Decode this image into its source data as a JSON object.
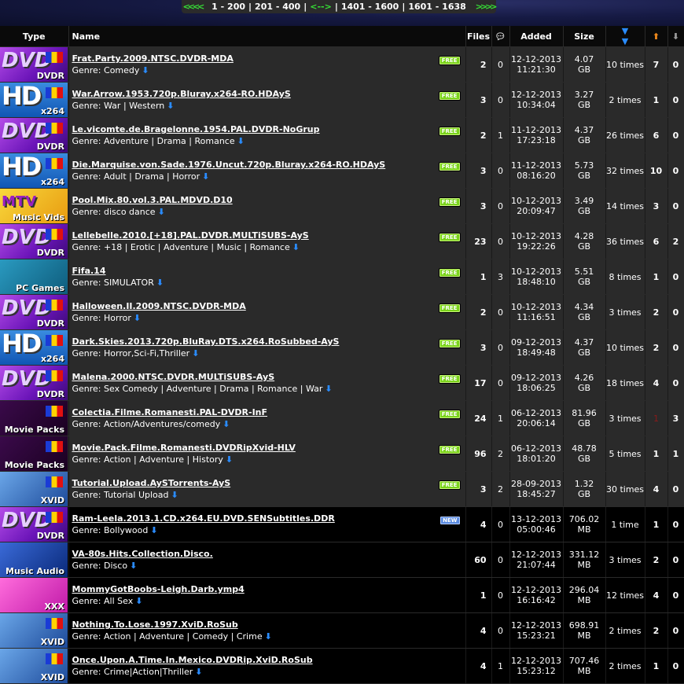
{
  "pager": {
    "left_arrows": "<<<<",
    "range_1": "1 - 200",
    "range_2": "201 - 400",
    "middle": "<-->",
    "range_3": "1401 - 1600",
    "range_4": "1601 - 1638",
    "right_arrows": ">>>>"
  },
  "columns": {
    "type": "Type",
    "name": "Name",
    "files": "Files",
    "comments_icon": "comment-icon",
    "added": "Added",
    "size": "Size",
    "snatched_icon": "snatched-icon",
    "seeders_icon": "up-arrow-icon",
    "leechers_icon": "down-arrow-icon"
  },
  "colors": {
    "free_badge": "#7bd31c",
    "new_badge": "#5a8be0",
    "download_icon": "#2a8cff",
    "dark_row": "#2a2a2a",
    "black_row": "#000000"
  },
  "rows": [
    {
      "cat": "dvd",
      "cat_label": "DVDR",
      "name": "Frat.Party.2009.NTSC.DVDR-MDA",
      "genre": "Genre: Comedy",
      "badge": "FREE",
      "files": "2",
      "comments": "0",
      "date": "12-12-2013",
      "time": "11:21:30",
      "size": "4.07",
      "unit": "GB",
      "snatched": "10 times",
      "seeders": "7",
      "leechers": "0",
      "style": "dark"
    },
    {
      "cat": "hd",
      "cat_label": "x264",
      "name": "War.Arrow.1953.720p.Bluray.x264-RO.HDAyS",
      "genre": "Genre: War | Western",
      "badge": "FREE",
      "files": "3",
      "comments": "0",
      "date": "12-12-2013",
      "time": "10:34:04",
      "size": "3.27",
      "unit": "GB",
      "snatched": "2 times",
      "seeders": "1",
      "leechers": "0",
      "style": "dark"
    },
    {
      "cat": "dvd",
      "cat_label": "DVDR",
      "name": "Le.vicomte.de.Bragelonne.1954.PAL.DVDR-NoGrup",
      "genre": "Genre:  Adventure | Drama | Romance",
      "badge": "FREE",
      "files": "2",
      "comments": "1",
      "date": "11-12-2013",
      "time": "17:23:18",
      "size": "4.37",
      "unit": "GB",
      "snatched": "26 times",
      "seeders": "6",
      "leechers": "0",
      "style": "dark"
    },
    {
      "cat": "hd",
      "cat_label": "x264",
      "name": "Die.Marquise.von.Sade.1976.Uncut.720p.Bluray.x264-RO.HDAyS",
      "genre": "Genre:  Adult | Drama | Horror",
      "badge": "FREE",
      "files": "3",
      "comments": "0",
      "date": "11-12-2013",
      "time": "08:16:20",
      "size": "5.73",
      "unit": "GB",
      "snatched": "32 times",
      "seeders": "10",
      "leechers": "0",
      "style": "dark"
    },
    {
      "cat": "music",
      "cat_label": "Music Vids",
      "name": "Pool.Mix.80.vol.3.PAL.MDVD.D10",
      "genre": "Genre: disco dance",
      "badge": "FREE",
      "files": "3",
      "comments": "0",
      "date": "10-12-2013",
      "time": "20:09:47",
      "size": "3.49",
      "unit": "GB",
      "snatched": "14 times",
      "seeders": "3",
      "leechers": "0",
      "style": "dark"
    },
    {
      "cat": "dvd",
      "cat_label": "DVDR",
      "name": "Lellebelle.2010.[+18].PAL.DVDR.MULTiSUBS-AyS",
      "genre": "Genre: +18 | Erotic | Adventure | Music | Romance",
      "badge": "FREE",
      "files": "23",
      "comments": "0",
      "date": "10-12-2013",
      "time": "19:22:26",
      "size": "4.28",
      "unit": "GB",
      "snatched": "36 times",
      "seeders": "6",
      "leechers": "2",
      "style": "dark"
    },
    {
      "cat": "games",
      "cat_label": "PC Games",
      "name": "Fifa.14",
      "genre": "Genre: SIMULATOR",
      "badge": "FREE",
      "files": "1",
      "comments": "3",
      "date": "10-12-2013",
      "time": "18:48:10",
      "size": "5.51",
      "unit": "GB",
      "snatched": "8 times",
      "seeders": "1",
      "leechers": "0",
      "style": "dark"
    },
    {
      "cat": "dvd",
      "cat_label": "DVDR",
      "name": "Halloween.II.2009.NTSC.DVDR-MDA",
      "genre": "Genre: Horror",
      "badge": "FREE",
      "files": "2",
      "comments": "0",
      "date": "10-12-2013",
      "time": "11:16:51",
      "size": "4.34",
      "unit": "GB",
      "snatched": "3 times",
      "seeders": "2",
      "leechers": "0",
      "style": "dark"
    },
    {
      "cat": "hd",
      "cat_label": "x264",
      "name": "Dark.Skies.2013.720p.BluRay.DTS.x264.RoSubbed-AyS",
      "genre": "Genre: Horror,Sci-Fi,Thriller",
      "badge": "FREE",
      "files": "3",
      "comments": "0",
      "date": "09-12-2013",
      "time": "18:49:48",
      "size": "4.37",
      "unit": "GB",
      "snatched": "10 times",
      "seeders": "2",
      "leechers": "0",
      "style": "dark"
    },
    {
      "cat": "dvd",
      "cat_label": "DVDR",
      "name": "Malena.2000.NTSC.DVDR.MULTiSUBS-AyS",
      "genre": "Genre: Sex Comedy | Adventure | Drama | Romance | War",
      "badge": "FREE",
      "files": "17",
      "comments": "0",
      "date": "09-12-2013",
      "time": "18:06:25",
      "size": "4.26",
      "unit": "GB",
      "snatched": "18 times",
      "seeders": "4",
      "leechers": "0",
      "style": "dark"
    },
    {
      "cat": "movie",
      "cat_label": "Movie Packs",
      "name": "Colectia.Filme.Romanesti.PAL-DVDR-InF",
      "genre": "Genre: Action/Adventures/comedy",
      "badge": "FREE",
      "files": "24",
      "comments": "1",
      "date": "06-12-2013",
      "time": "20:06:14",
      "size": "81.96",
      "unit": "GB",
      "snatched": "3 times",
      "seeders": "1",
      "leechers": "3",
      "style": "dark",
      "seeders_dim": true
    },
    {
      "cat": "movie",
      "cat_label": "Movie Packs",
      "name": "Movie.Pack.Filme.Romanesti.DVDRipXvid-HLV",
      "genre": "Genre: Action | Adventure | History",
      "badge": "FREE",
      "files": "96",
      "comments": "2",
      "date": "06-12-2013",
      "time": "18:01:20",
      "size": "48.78",
      "unit": "GB",
      "snatched": "5 times",
      "seeders": "1",
      "leechers": "1",
      "style": "dark"
    },
    {
      "cat": "xvid",
      "cat_label": "XVID",
      "name": "Tutorial.Upload.AySTorrents-AyS",
      "genre": "Genre: Tutorial Upload",
      "badge": "FREE",
      "files": "3",
      "comments": "2",
      "date": "28-09-2013",
      "time": "18:45:27",
      "size": "1.32",
      "unit": "GB",
      "snatched": "30 times",
      "seeders": "4",
      "leechers": "0",
      "style": "dark"
    },
    {
      "cat": "dvd",
      "cat_label": "DVDR",
      "name": "Ram-Leela.2013.1.CD.x264.EU.DVD.SENSubtitles.DDR",
      "genre": "Genre:  Bollywood",
      "badge": "NEW",
      "files": "4",
      "comments": "0",
      "date": "13-12-2013",
      "time": "05:00:46",
      "size": "706.02",
      "unit": "MB",
      "snatched": "1 time",
      "seeders": "1",
      "leechers": "0",
      "style": "black"
    },
    {
      "cat": "audio",
      "cat_label": "Music Audio",
      "name": "VA-80s.Hits.Collection.Disco.",
      "genre": "Genre: Disco",
      "badge": "",
      "files": "60",
      "comments": "0",
      "date": "12-12-2013",
      "time": "21:07:44",
      "size": "331.12",
      "unit": "MB",
      "snatched": "3 times",
      "seeders": "2",
      "leechers": "0",
      "style": "black"
    },
    {
      "cat": "xxx",
      "cat_label": "XXX",
      "name": "MommyGotBoobs-Leigh.Darb.ymp4",
      "genre": "Genre: All Sex",
      "badge": "",
      "files": "1",
      "comments": "0",
      "date": "12-12-2013",
      "time": "16:16:42",
      "size": "296.04",
      "unit": "MB",
      "snatched": "12 times",
      "seeders": "4",
      "leechers": "0",
      "style": "black"
    },
    {
      "cat": "xvid",
      "cat_label": "XVID",
      "name": "Nothing.To.Lose.1997.XviD.RoSub",
      "genre": "Genre: Action | Adventure | Comedy | Crime",
      "badge": "",
      "files": "4",
      "comments": "0",
      "date": "12-12-2013",
      "time": "15:23:21",
      "size": "698.91",
      "unit": "MB",
      "snatched": "2 times",
      "seeders": "2",
      "leechers": "0",
      "style": "black"
    },
    {
      "cat": "xvid",
      "cat_label": "XVID",
      "name": "Once.Upon.A.Time.In.Mexico.DVDRip.XviD.RoSub",
      "genre": "Genre: Crime|Action|Thriller",
      "badge": "",
      "files": "4",
      "comments": "1",
      "date": "12-12-2013",
      "time": "15:23:12",
      "size": "707.46",
      "unit": "MB",
      "snatched": "2 times",
      "seeders": "1",
      "leechers": "0",
      "style": "black"
    }
  ]
}
